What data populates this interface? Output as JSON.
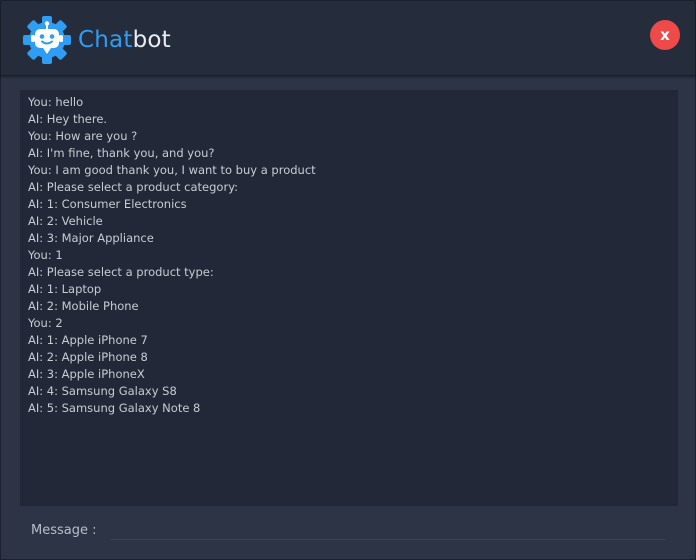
{
  "header": {
    "logo_icon": "robot-gear-icon",
    "title_part1": "Chat",
    "title_part2": "bot",
    "close_label": "x",
    "colors": {
      "accent": "#2f9df4",
      "close": "#ef4a4a"
    }
  },
  "chat": {
    "lines": [
      "You: hello",
      "AI: Hey there.",
      "You: How are you ?",
      "AI: I'm fine, thank you, and you?",
      "You: I am good thank you, I want to buy a product",
      "AI: Please select a product category:",
      "AI: 1: Consumer Electronics",
      "AI: 2: Vehicle",
      "AI: 3: Major Appliance",
      "You: 1",
      "AI: Please select a product type:",
      "AI: 1: Laptop",
      "AI: 2: Mobile Phone",
      "You: 2",
      "AI: 1: Apple iPhone 7",
      "AI: 2: Apple iPhone 8",
      "AI: 3: Apple iPhoneX",
      "AI: 4: Samsung Galaxy S8",
      "AI: 5: Samsung Galaxy Note 8"
    ]
  },
  "composer": {
    "label": "Message :",
    "value": ""
  }
}
